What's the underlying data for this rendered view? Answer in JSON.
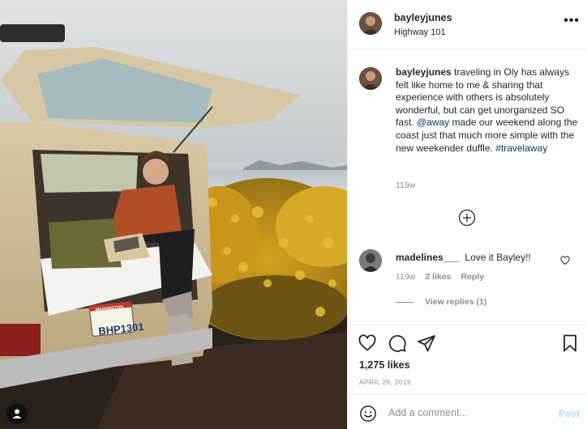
{
  "post": {
    "username": "bayleyjunes",
    "location": "Highway 101",
    "more_label": "•••",
    "license_plate": "BHP1301",
    "plate_state": "WASHINGTON"
  },
  "caption": {
    "username": "bayleyjunes",
    "text_before_mention": " traveling in Oly has always felt like home to me & sharing that experience with others is absolutely wonderful, but can get unorganized SO fast. ",
    "mention": "@away",
    "text_after_mention": " made our weekend along the coast just that much more simple with the new weekender duffle. ",
    "hashtag": "#travelaway",
    "age": "119w"
  },
  "comment": {
    "username": "madelines___",
    "text": "Love it Bayley!!",
    "age": "119w",
    "likes": "2 likes",
    "reply_label": "Reply",
    "view_replies": "View replies (1)"
  },
  "engagement": {
    "likes": "1,275 likes",
    "date": "APRIL 26, 2019"
  },
  "add_comment": {
    "placeholder": "Add a comment...",
    "post_label": "Post"
  },
  "icons": {
    "like": "heart-icon",
    "comment": "comment-bubble-icon",
    "share": "paper-plane-icon",
    "save": "bookmark-icon",
    "emoji": "smiley-icon",
    "load_more": "plus-circle-icon",
    "tagged_user": "user-icon"
  },
  "colors": {
    "text": "#262626",
    "secondary": "#8e8e8e",
    "link": "#00376b",
    "post_disabled": "#b2dffc",
    "border": "#efefef"
  }
}
